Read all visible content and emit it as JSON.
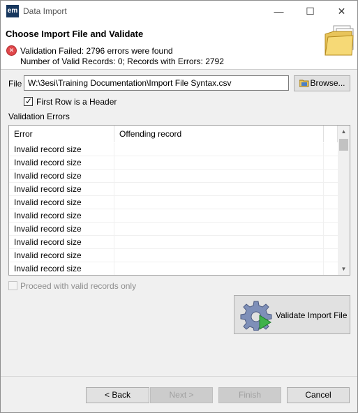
{
  "window": {
    "title": "Data Import",
    "app_icon": "em",
    "minimize": "—",
    "maximize": "☐",
    "close": "✕"
  },
  "header": {
    "title": "Choose Import File and Validate",
    "error_message": "Validation Failed: 2796 errors were found",
    "summary": "Number of Valid Records: 0; Records with Errors: 2792"
  },
  "file": {
    "label": "File",
    "value": "W:\\3esi\\Training Documentation\\Import File Syntax.csv",
    "browse_label": "Browse..."
  },
  "first_row_header": {
    "label": "First Row is a Header",
    "checked": true
  },
  "validation": {
    "label": "Validation Errors",
    "columns": [
      "Error",
      "Offending record"
    ],
    "rows": [
      {
        "error": "Invalid record size",
        "record": ""
      },
      {
        "error": "Invalid record size",
        "record": ""
      },
      {
        "error": "Invalid record size",
        "record": ""
      },
      {
        "error": "Invalid record size",
        "record": ""
      },
      {
        "error": "Invalid record size",
        "record": ""
      },
      {
        "error": "Invalid record size",
        "record": ""
      },
      {
        "error": "Invalid record size",
        "record": ""
      },
      {
        "error": "Invalid record size",
        "record": ""
      },
      {
        "error": "Invalid record size",
        "record": ""
      },
      {
        "error": "Invalid record size",
        "record": ""
      }
    ]
  },
  "proceed": {
    "label": "Proceed with valid records only",
    "checked": false,
    "enabled": false
  },
  "validate_button": {
    "label": "Validate Import File"
  },
  "footer": {
    "back": "< Back",
    "next": "Next >",
    "finish": "Finish",
    "cancel": "Cancel"
  },
  "colors": {
    "error_red": "#e0484b",
    "button_bg": "#e1e1e1",
    "window_bg": "#f0f0f0"
  }
}
